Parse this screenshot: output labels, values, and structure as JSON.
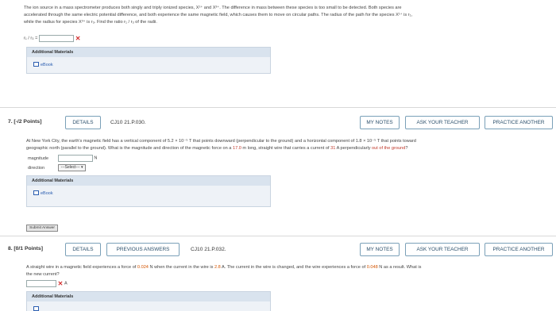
{
  "q6": {
    "text_line1": "The ion source in a mass spectrometer produces both singly and triply ionized species, X¹⁺ and X³⁺. The difference in mass between these species is too small to be detected. Both species are",
    "text_line2": "accelerated through the same electric potential difference, and both experience the same magnetic field, which causes them to move on circular paths. The radius of the path for the species X¹⁺ is r₁,",
    "text_line3": "while the radius for species X³⁺ is r₃. Find the ratio r₁ / r₃ of the radii.",
    "answer_label": "r₁ / r₃ =",
    "answer_value": "",
    "additional_materials": "Additional Materials",
    "ebook": "eBook"
  },
  "q7": {
    "number": "7.",
    "points": "[-/2 Points]",
    "details": "DETAILS",
    "code": "CJ10 21.P.030.",
    "my_notes": "MY NOTES",
    "ask_teacher": "ASK YOUR TEACHER",
    "practice": "PRACTICE ANOTHER",
    "text_a": "At New York City, the earth's magnetic field has a vertical component of 5.2 × 10⁻⁵ T that points downward (perpendicular to the ground) and a horizontal component of 1.8 × 10⁻⁵ T that points toward",
    "text_b1": "geographic north (parallel to the ground). What is the magnitude and direction of the magnetic force on a ",
    "length": "17.0",
    "text_b2": " m long, straight wire that carries a current of ",
    "current": "31",
    "text_b3": " A perpendicularly ",
    "direction_phrase": "out of the ground",
    "text_b4": "?",
    "magnitude_label": "magnitude",
    "magnitude_unit": "N",
    "direction_label": "direction",
    "direction_select": "---Select---",
    "additional_materials": "Additional Materials",
    "ebook": "eBook",
    "submit": "Submit Answer"
  },
  "q8": {
    "number": "8.",
    "points": "[0/1 Points]",
    "details": "DETAILS",
    "previous": "PREVIOUS ANSWERS",
    "code": "CJ10 21.P.032.",
    "my_notes": "MY NOTES",
    "ask_teacher": "ASK YOUR TEACHER",
    "practice": "PRACTICE ANOTHER",
    "text_a1": "A straight wire in a magnetic field experiences a force of ",
    "force1": "0.024",
    "text_a2": " N when the current in the wire is ",
    "current1": "2.8",
    "text_a3": " A. The current in the wire is changed, and the wire experiences a force of ",
    "force2": "0.048",
    "text_a4": " N as a result. What is",
    "text_b": "the new current?",
    "unit": "A",
    "additional_materials": "Additional Materials"
  }
}
